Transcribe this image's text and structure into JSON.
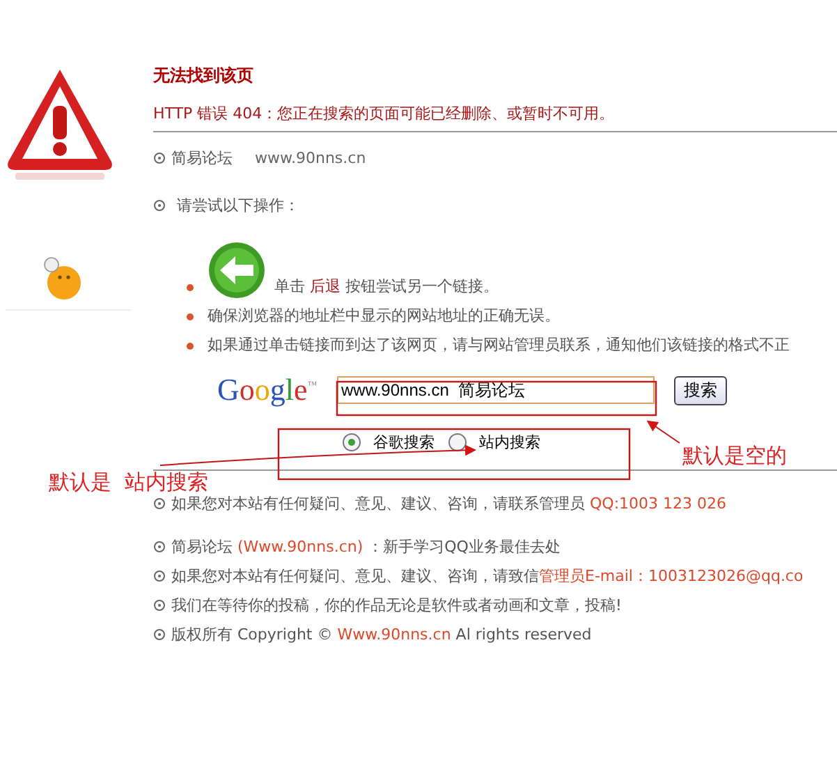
{
  "error": {
    "title": "无法找到该页",
    "message": "HTTP 错误 404：您正在搜索的页面可能已经删除、或暂时不可用。"
  },
  "site": {
    "name": "简易论坛",
    "url": "www.90nns.cn"
  },
  "prompt": "请尝试以下操作：",
  "suggestions": [
    {
      "kind": "back",
      "segments": [
        {
          "text": "单击 ",
          "highlight": false
        },
        {
          "text": "后退",
          "highlight": true
        },
        {
          "text": " 按钮尝试另一个链接。",
          "highlight": false
        }
      ]
    },
    {
      "kind": "plain",
      "segments": [
        {
          "text": "确保浏览器的地址栏中显示的网站地址的正确无误。",
          "highlight": false
        }
      ]
    },
    {
      "kind": "plain",
      "segments": [
        {
          "text": "如果通过单击链接而到达了该网页，请与网站管理员联系，通知他们该链接的格式不正",
          "highlight": false
        }
      ]
    }
  ],
  "search": {
    "logo": "Google",
    "trademark": "™",
    "value": "www.90nns.cn  简易论坛",
    "button": "搜索",
    "options": [
      {
        "label": "谷歌搜索",
        "selected": true
      },
      {
        "label": "站内搜索",
        "selected": false
      }
    ]
  },
  "annotations": [
    {
      "kind": "left",
      "text": "默认是  站内搜索"
    },
    {
      "kind": "right",
      "text": "默认是空的"
    }
  ],
  "contact": [
    {
      "text": "如果您对本站有任何疑问、意见、建议、咨询，请联系管理员 ",
      "highlight": false
    },
    {
      "text": "QQ:1003 123 026",
      "highlight": true
    }
  ],
  "footer": [
    [
      {
        "text": "简易论坛 ",
        "highlight": false
      },
      {
        "text": "(Www.90nns.cn)",
        "highlight": true
      },
      {
        "text": " ：新手学习QQ业务最佳去处",
        "highlight": false
      }
    ],
    [
      {
        "text": "如果您对本站有任何疑问、意见、建议、咨询，请致信",
        "highlight": false
      },
      {
        "text": "管理员E-mail：1003123026@qq.co",
        "highlight": true
      }
    ],
    [
      {
        "text": "我们在等待你的投稿，你的作品无论是软件或者动画和文章，投稿!",
        "highlight": false
      }
    ],
    [
      {
        "text": "版权所有 Copyright © ",
        "highlight": false
      },
      {
        "text": "Www.90nns.cn",
        "highlight": true
      },
      {
        "text": " Al rights reserved",
        "highlight": false
      }
    ]
  ]
}
